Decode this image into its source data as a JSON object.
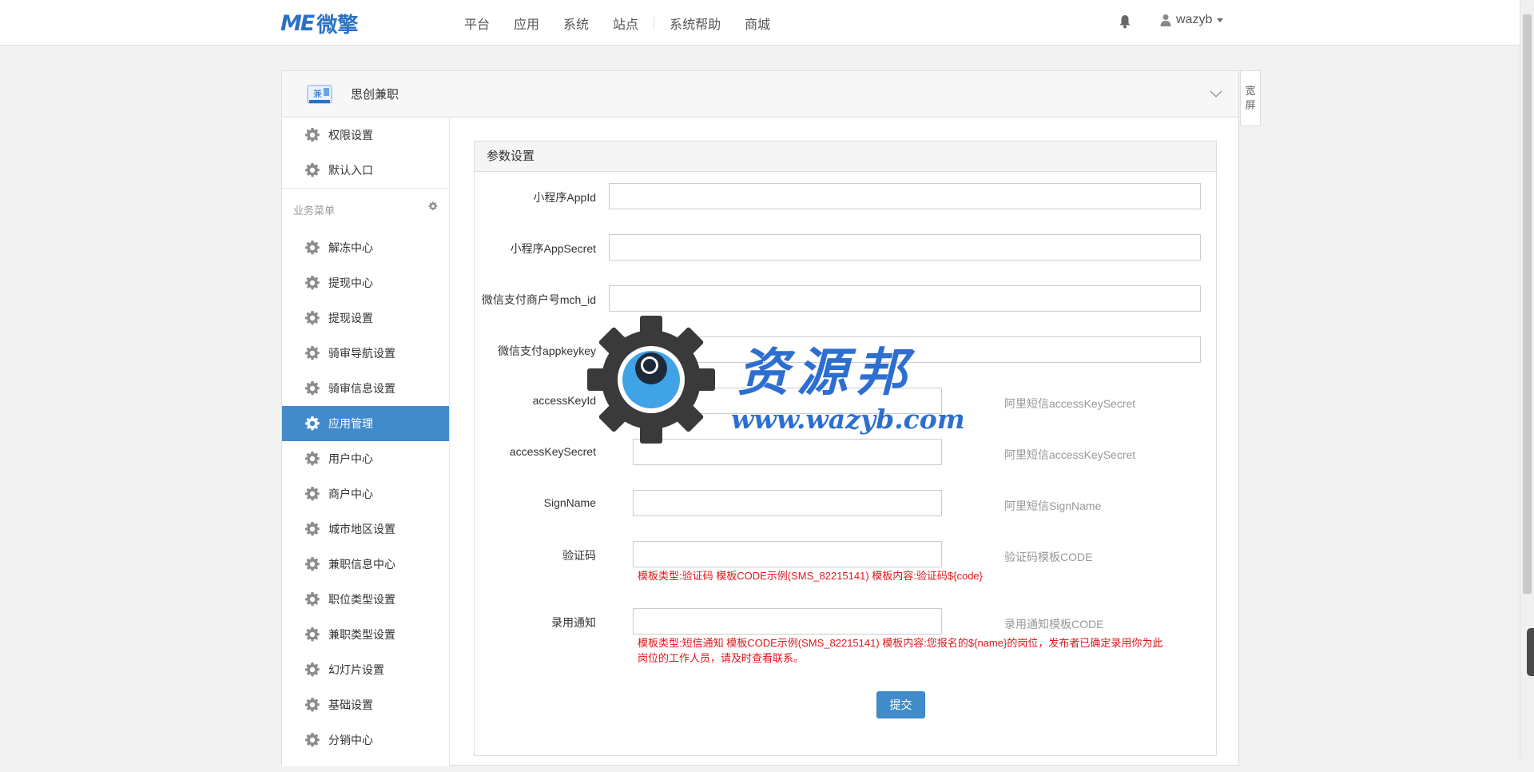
{
  "navbar": {
    "logo_mark": "ME",
    "logo_text": "微擎",
    "items": [
      "平台",
      "应用",
      "系统",
      "站点",
      "系统帮助",
      "商城"
    ],
    "username": "wazyb"
  },
  "panel": {
    "app_title": "思创兼职",
    "app_icon_text": "兼",
    "wide_label_1": "宽",
    "wide_label_2": "屏"
  },
  "sidebar": {
    "top_items": [
      "权限设置",
      "默认入口"
    ],
    "group_title": "业务菜单",
    "items": [
      "解冻中心",
      "提现中心",
      "提现设置",
      "骑审导航设置",
      "骑审信息设置",
      "应用管理",
      "用户中心",
      "商户中心",
      "城市地区设置",
      "兼职信息中心",
      "职位类型设置",
      "兼职类型设置",
      "幻灯片设置",
      "基础设置",
      "分销中心"
    ],
    "active_index": 5
  },
  "form": {
    "title": "参数设置",
    "fields": {
      "appid": {
        "label": "小程序AppId",
        "value": ""
      },
      "appsecret": {
        "label": "小程序AppSecret",
        "value": ""
      },
      "mch_id": {
        "label": "微信支付商户号mch_id",
        "value": ""
      },
      "appkey": {
        "label": "微信支付appkeykey",
        "value": ""
      },
      "accesskeyid": {
        "label": "accessKeyId",
        "value": "",
        "hint": "阿里短信accessKeySecret"
      },
      "accesskeysecret": {
        "label": "accessKeySecret",
        "value": "",
        "hint": "阿里短信accessKeySecret"
      },
      "signname": {
        "label": "SignName",
        "value": "",
        "hint": "阿里短信SignName"
      },
      "code": {
        "label": "验证码",
        "value": "",
        "hint": "验证码模板CODE",
        "note": "模板类型:验证码 模板CODE示例(SMS_82215141) 模板内容:验证码${code}"
      },
      "hire": {
        "label": "录用通知",
        "value": "",
        "hint": "录用通知模板CODE",
        "note_line1": "模板类型:短信通知 模板CODE示例(SMS_82215141) 模板内容:您报名的${name}的岗位，发布者已确定录用你为此",
        "note_line2": "岗位的工作人员，请及时查看联系。"
      }
    },
    "submit_label": "提交"
  },
  "watermark": {
    "cn": "资源邦",
    "url": "www.wazyb.com"
  },
  "colors": {
    "accent": "#428bca",
    "warning_text": "#e0161b",
    "brand": "#2b72c4"
  }
}
